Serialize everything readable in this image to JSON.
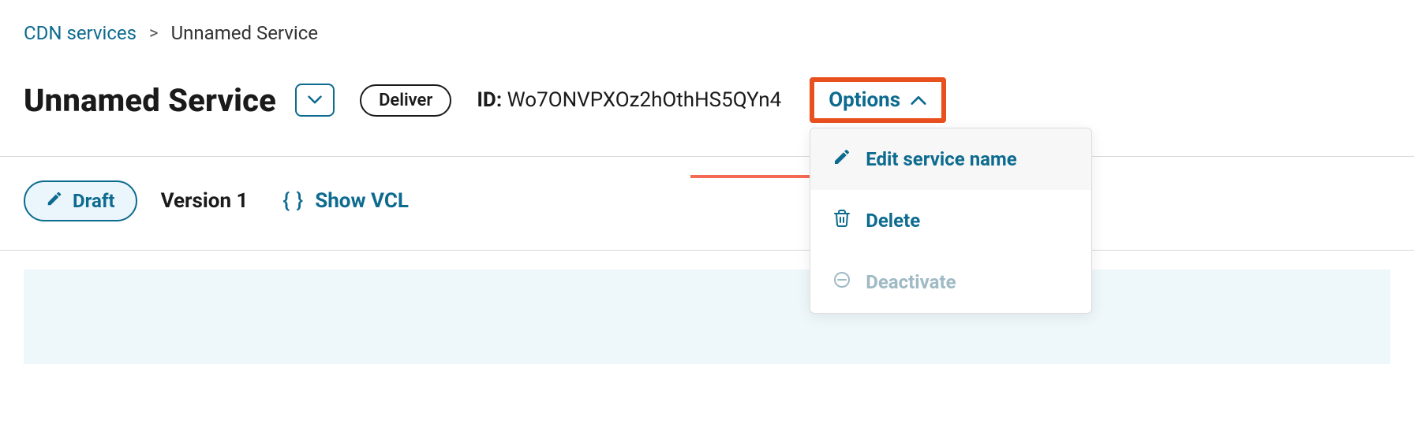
{
  "breadcrumb": {
    "root": "CDN services",
    "sep": ">",
    "current": "Unnamed Service"
  },
  "header": {
    "title": "Unnamed Service",
    "deliver_label": "Deliver",
    "id_label": "ID:",
    "id_value": "Wo7ONVPXOz2hOthHS5QYn4",
    "options_label": "Options"
  },
  "options_menu": {
    "edit": "Edit service name",
    "delete": "Delete",
    "deactivate": "Deactivate"
  },
  "version_bar": {
    "draft_label": "Draft",
    "version_label": "Version 1",
    "show_vcl_label": "Show VCL"
  },
  "colors": {
    "link": "#0d6b8f",
    "accent_highlight": "#e8501e",
    "pill_bg": "#eaf6fb"
  }
}
